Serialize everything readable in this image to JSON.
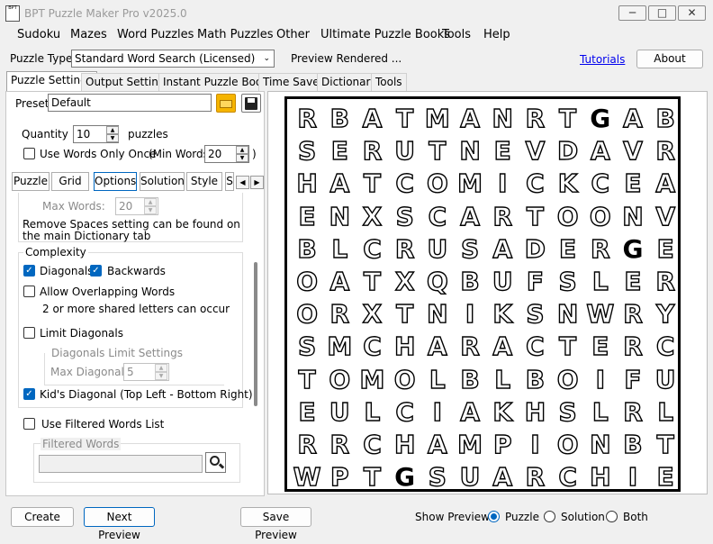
{
  "window": {
    "title": "BPT Puzzle Maker Pro v2025.0",
    "icon_text": "BPT",
    "minimize_icon": "minimize-icon",
    "maximize_icon": "maximize-icon",
    "close_icon": "close-icon"
  },
  "menu": [
    "Sudoku",
    "Mazes",
    "Word Puzzles",
    "Math Puzzles",
    "Other",
    "Ultimate Puzzle Books",
    "Tools",
    "Help"
  ],
  "toolbar": {
    "puzzle_type_label": "Puzzle Type",
    "puzzle_type_value": "Standard Word Search (Licensed)",
    "preview_status": "Preview Rendered ...",
    "tutorials_link": "Tutorials",
    "about_button": "About"
  },
  "tabs": [
    "Puzzle Settings",
    "Output Settings",
    "Instant Puzzle Books",
    "Time Saver",
    "Dictionary",
    "Tools"
  ],
  "settings": {
    "preset_label": "Preset",
    "preset_value": "Default",
    "quantity_label": "Quantity",
    "quantity_value": "10",
    "puzzles_label": "puzzles",
    "use_words_once_label": "Use Words Only Once",
    "min_words_label": "(Min Words:",
    "min_words_value": "20",
    "min_words_close": ")",
    "subtabs": [
      "Puzzle",
      "Grid",
      "Options",
      "Solution",
      "Style",
      "S"
    ],
    "max_words_label": "Max Words:",
    "max_words_value": "20",
    "remove_spaces_note": "Remove Spaces setting can be found on the main Dictionary tab",
    "complexity_label": "Complexity",
    "diagonals_label": "Diagonals",
    "diagonals_checked": true,
    "backwards_label": "Backwards",
    "backwards_checked": true,
    "overlap_label": "Allow Overlapping Words",
    "overlap_checked": false,
    "overlap_note": "2 or more shared letters can occur",
    "limit_diagonals_label": "Limit Diagonals",
    "limit_diagonals_checked": false,
    "diag_limit_settings_label": "Diagonals Limit Settings",
    "max_diagonals_label": "Max Diagonals",
    "max_diagonals_value": "5",
    "kids_diagonal_label": "Kid's Diagonal (Top Left - Bottom Right)",
    "kids_diagonal_checked": true,
    "filtered_list_label": "Use Filtered Words List",
    "filtered_list_checked": false,
    "filtered_words_label": "Filtered Words",
    "filtered_words_value": ""
  },
  "bottom": {
    "create_button": "Create",
    "next_preview_button": "Next Preview",
    "save_preview_button": "Save Preview",
    "show_preview_label": "Show Preview:",
    "options": [
      "Puzzle",
      "Solution",
      "Both"
    ],
    "selected": "Puzzle"
  },
  "puzzle_grid": [
    "RBATMANRTGAB",
    "SERUTNEVDAVR",
    "HATCOMICKCEA",
    "ENXSCARTOONV",
    "BLCRUSADERGE",
    "OATXQBUFSLER",
    "ORXTNIKSNWRY",
    "SMCHARACTERC",
    "TOMOLBLBOIFU",
    "EULCIAKHSLRL",
    "RRCHAMPIONBT",
    "WPTGSUARCHIE"
  ],
  "filled_letters": [
    [
      0,
      9
    ],
    [
      4,
      10
    ],
    [
      11,
      3
    ]
  ]
}
